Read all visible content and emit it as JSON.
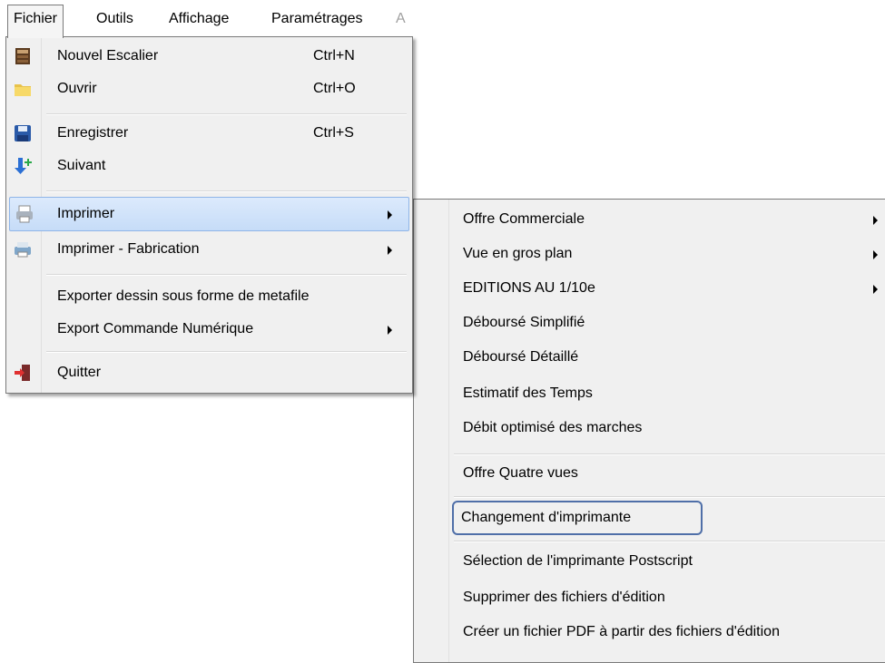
{
  "menubar": {
    "items": [
      {
        "label": "Fichier"
      },
      {
        "label": "Outils"
      },
      {
        "label": "Affichage"
      },
      {
        "label": "Paramétrages"
      },
      {
        "label": "A"
      }
    ]
  },
  "fichier_menu": {
    "items": [
      {
        "label": "Nouvel Escalier",
        "shortcut": "Ctrl+N",
        "icon": "staircase-icon"
      },
      {
        "label": "Ouvrir",
        "shortcut": "Ctrl+O",
        "icon": "folder-icon"
      },
      {
        "label": "Enregistrer",
        "shortcut": "Ctrl+S",
        "icon": "floppy-disk-icon"
      },
      {
        "label": "Suivant",
        "icon": "arrow-down-plus-icon"
      },
      {
        "label": "Imprimer",
        "icon": "printer-icon"
      },
      {
        "label": "Imprimer - Fabrication",
        "icon": "printer-icon"
      },
      {
        "label": "Exporter dessin sous forme de metafile"
      },
      {
        "label": "Export Commande Numérique"
      },
      {
        "label": "Quitter",
        "icon": "exit-door-icon"
      }
    ]
  },
  "imprimer_submenu": {
    "items": [
      {
        "label": "Offre Commerciale"
      },
      {
        "label": "Vue en gros plan"
      },
      {
        "label": "EDITIONS AU 1/10e"
      },
      {
        "label": "Déboursé Simplifié"
      },
      {
        "label": "Déboursé Détaillé"
      },
      {
        "label": "Estimatif des Temps"
      },
      {
        "label": "Débit optimisé des marches"
      },
      {
        "label": "Offre Quatre vues"
      },
      {
        "label": "Changement d'imprimante"
      },
      {
        "label": "Sélection de l'imprimante Postscript"
      },
      {
        "label": "Supprimer des fichiers d'édition"
      },
      {
        "label": "Créer un fichier PDF à partir des fichiers d'édition"
      }
    ]
  },
  "colors": {
    "menu_bg": "#f0f0f0",
    "highlight": "#c6dcf8",
    "callout_border": "#4f6fa8"
  }
}
